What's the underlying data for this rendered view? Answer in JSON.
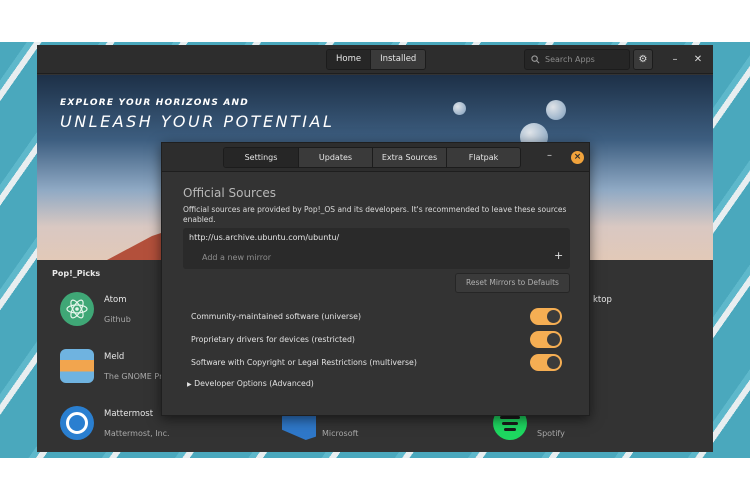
{
  "header": {
    "view_tabs": [
      "Home",
      "Installed"
    ],
    "search_placeholder": "Search Apps"
  },
  "banner": {
    "line1": "EXPLORE YOUR HORIZONS AND",
    "line2": "UNLEASH YOUR POTENTIAL"
  },
  "picks": {
    "title": "Pop!_Picks",
    "apps": [
      {
        "name": "Atom",
        "sub": "Github",
        "icon": "atom-icon",
        "color": "#3fa776"
      },
      {
        "name": "Meld",
        "sub": "The GNOME Pro",
        "icon": "meld-icon",
        "color": "#f2a54e"
      },
      {
        "name": "Mattermost",
        "sub": "Mattermost, Inc.",
        "icon": "mattermost-icon",
        "color": "#2a7fd0"
      },
      {
        "name": "",
        "sub": "Microsoft",
        "icon": "vscode-icon",
        "color": "#2f78c9"
      },
      {
        "name": "",
        "sub": "Spotify",
        "icon": "spotify-icon",
        "color": "#1ed760"
      },
      {
        "name": "ktop",
        "sub": "",
        "icon": "",
        "color": ""
      }
    ]
  },
  "dialog": {
    "tabs": [
      "Settings",
      "Updates",
      "Extra Sources",
      "Flatpak"
    ],
    "section_title": "Official Sources",
    "section_desc": "Official sources are provided by Pop!_OS and its developers. It's recommended to leave these sources enabled.",
    "mirror_url": "http://us.archive.ubuntu.com/ubuntu/",
    "mirror_placeholder": "Add a new mirror",
    "reset_label": "Reset Mirrors to Defaults",
    "toggles": [
      {
        "label": "Community-maintained software (universe)",
        "on": true
      },
      {
        "label": "Proprietary drivers for devices (restricted)",
        "on": true
      },
      {
        "label": "Software with Copyright or Legal Restrictions (multiverse)",
        "on": true
      }
    ],
    "dev_options": "Developer Options (Advanced)",
    "accent": "#f5ae53"
  }
}
